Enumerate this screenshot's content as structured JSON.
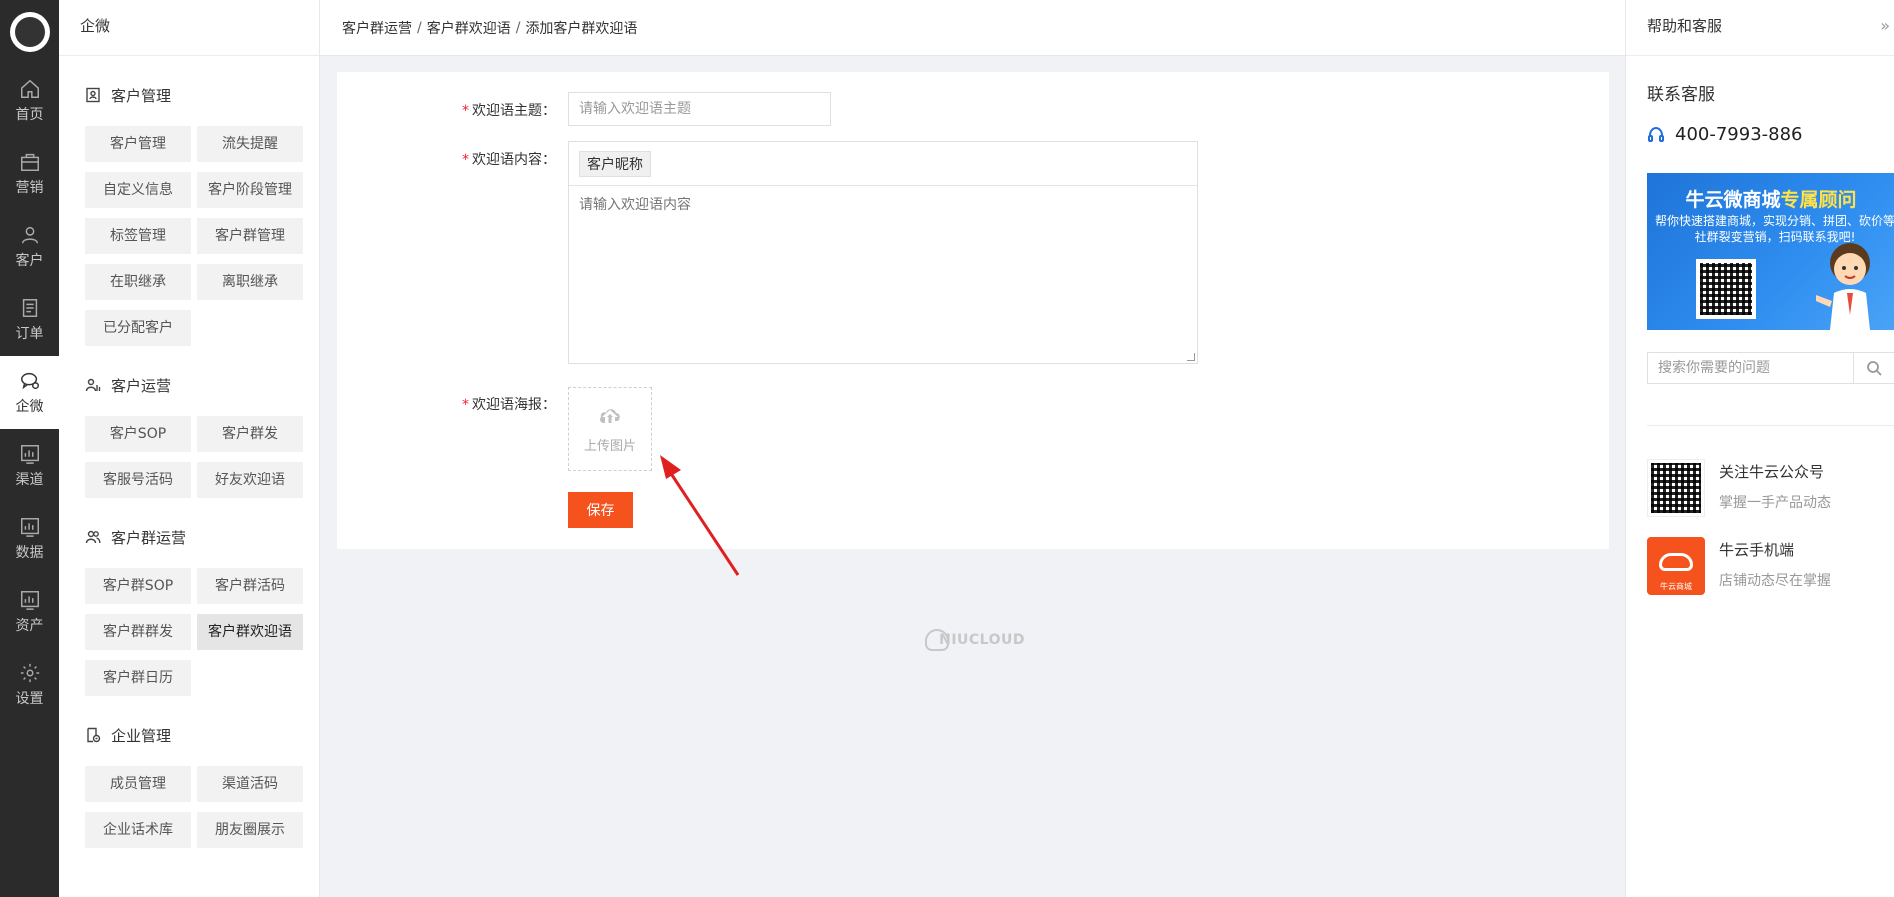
{
  "rail": {
    "items": [
      {
        "label": "首页",
        "icon": "home-icon"
      },
      {
        "label": "营销",
        "icon": "bag-icon"
      },
      {
        "label": "客户",
        "icon": "user-icon"
      },
      {
        "label": "订单",
        "icon": "order-icon"
      },
      {
        "label": "企微",
        "icon": "chat-icon",
        "active": true
      },
      {
        "label": "渠道",
        "icon": "chart-icon"
      },
      {
        "label": "数据",
        "icon": "chart-icon"
      },
      {
        "label": "资产",
        "icon": "chart-icon"
      },
      {
        "label": "设置",
        "icon": "gear-icon"
      }
    ]
  },
  "sidebar": {
    "brand": "企微",
    "groups": [
      {
        "title": "客户管理",
        "items": [
          "客户管理",
          "流失提醒",
          "自定义信息",
          "客户阶段管理",
          "标签管理",
          "客户群管理",
          "在职继承",
          "离职继承",
          "已分配客户"
        ]
      },
      {
        "title": "客户运营",
        "items": [
          "客户SOP",
          "客户群发",
          "客服号活码",
          "好友欢迎语"
        ]
      },
      {
        "title": "客户群运营",
        "items": [
          "客户群SOP",
          "客户群活码",
          "客户群群发",
          "客户群欢迎语",
          "客户群日历"
        ]
      },
      {
        "title": "企业管理",
        "items": [
          "成员管理",
          "渠道活码",
          "企业话术库",
          "朋友圈展示"
        ]
      }
    ],
    "active_item": "客户群欢迎语"
  },
  "breadcrumb": {
    "items": [
      "客户群运营",
      "客户群欢迎语",
      "添加客户群欢迎语"
    ],
    "separator": "/"
  },
  "form": {
    "required_mark": "*",
    "title_label": "欢迎语主题：",
    "title_placeholder": "请输入欢迎语主题",
    "content_label": "欢迎语内容：",
    "nickname_button": "客户昵称",
    "content_placeholder": "请输入欢迎语内容",
    "poster_label": "欢迎语海报：",
    "upload_text": "上传图片",
    "save_label": "保存"
  },
  "watermark": "NIUCLOUD",
  "help": {
    "header": "帮助和客服",
    "collapse_icon": "»",
    "contact_title": "联系客服",
    "phone": "400-7993-886",
    "banner_title_a": "牛云微商城",
    "banner_title_b": "专属顾问",
    "banner_sub": "帮你快速搭建商城，实现分销、拼团、砍价等社群裂变营销，扫码联系我吧!",
    "search_placeholder": "搜索你需要的问题",
    "follow": [
      {
        "title": "关注牛云公众号",
        "desc": "掌握一手产品动态"
      },
      {
        "title": "牛云手机端",
        "desc": "店铺动态尽在掌握",
        "badge": "牛云商城"
      }
    ]
  },
  "colors": {
    "accent": "#f5521d",
    "rail_bg": "#2b2b2b",
    "required": "#f5222d",
    "banner_blue": "#1f74d8"
  }
}
